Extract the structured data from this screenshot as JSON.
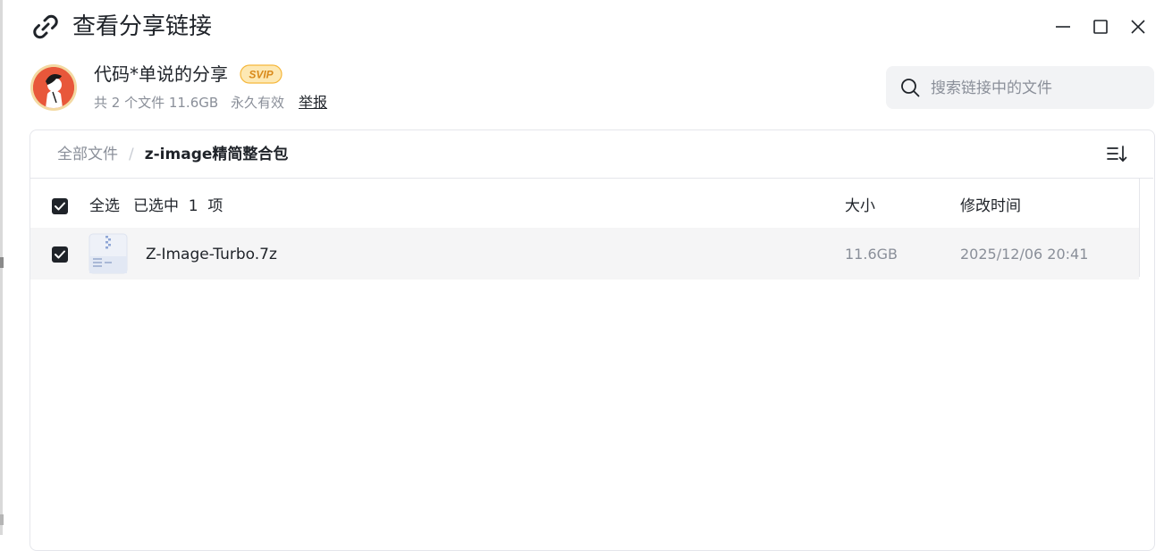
{
  "window": {
    "title": "查看分享链接",
    "icons": [
      "link-icon",
      "minimize-icon",
      "maximize-icon",
      "close-icon"
    ]
  },
  "share": {
    "sharer_name": "代码*单说的分享",
    "badge": "SVIP",
    "file_count": "共 2 个文件 11.6GB",
    "validity": "永久有效",
    "report_label": "举报"
  },
  "search": {
    "placeholder": "搜索链接中的文件",
    "value": ""
  },
  "breadcrumb": {
    "root": "全部文件",
    "separator": "/",
    "current": "z-image精简整合包"
  },
  "list": {
    "select_all_label": "全选",
    "selected_text": "已选中  1  项",
    "columns": {
      "size": "大小",
      "modified": "修改时间"
    },
    "files": [
      {
        "name": "Z-Image-Turbo.7z",
        "size": "11.6GB",
        "modified": "2025/12/06 20:41",
        "checked": true,
        "icon": "zip-file-icon"
      }
    ]
  },
  "colors": {
    "accent_dark": "#1f2329",
    "muted_text": "#8a8f99",
    "selected_row": "#f5f5f6",
    "search_bg": "#f2f3f5",
    "svip_gold": "#f5b73b"
  }
}
